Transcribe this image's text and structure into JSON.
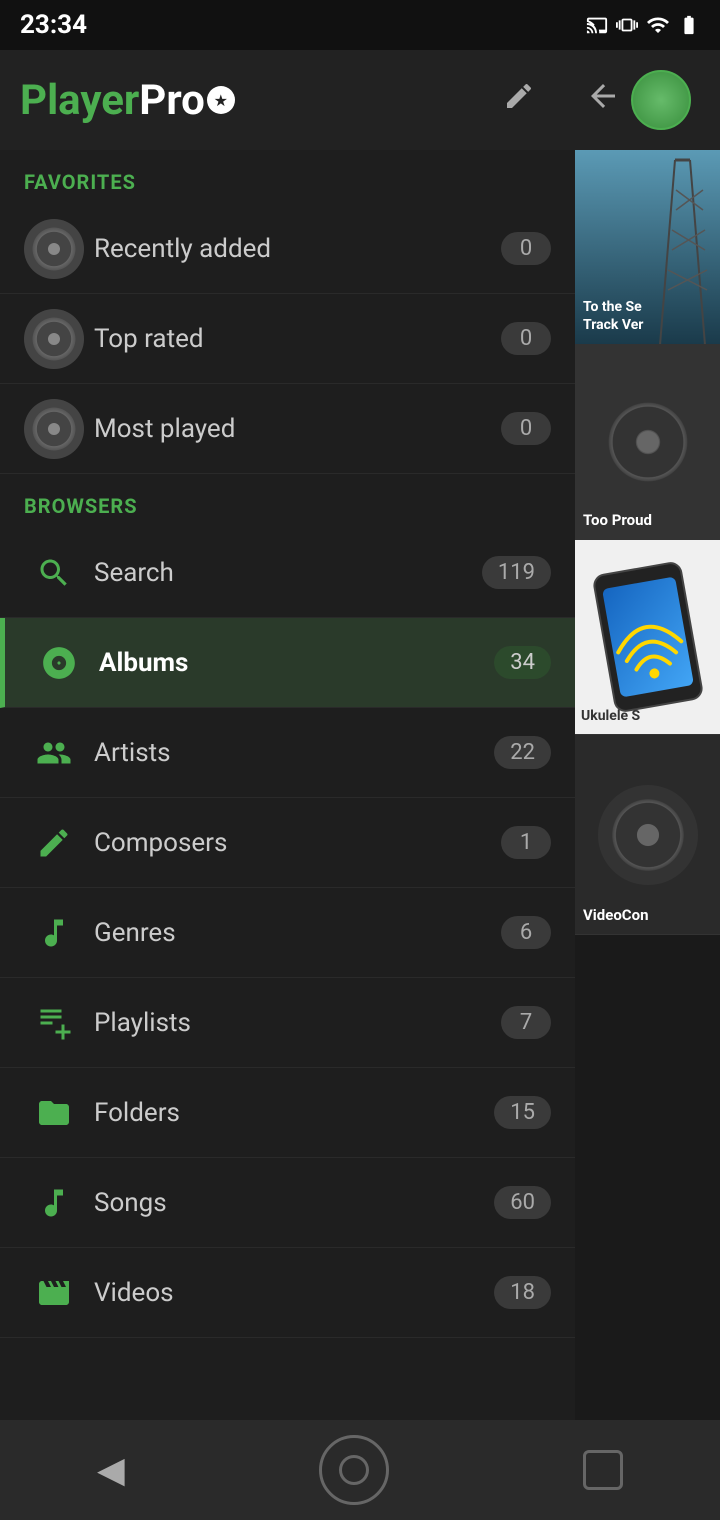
{
  "status": {
    "time": "23:34",
    "icons": [
      "cast",
      "vibrate",
      "wifi",
      "battery"
    ]
  },
  "header": {
    "logo_player": "Player",
    "logo_pro": "Pro",
    "edit_icon": "✏"
  },
  "right_panel": {
    "back_icon": "←",
    "card1": {
      "title": "To the Se",
      "subtitle": "Track Ver"
    },
    "card2": {
      "title": "Too Proud"
    },
    "card3": {
      "title": "Ukulele S"
    },
    "card4": {
      "title": "VideoCon"
    }
  },
  "drawer": {
    "favorites_label": "FAVORITES",
    "browsers_label": "BROWSERS",
    "items_favorites": [
      {
        "id": "recently-added",
        "label": "Recently added",
        "count": "0"
      },
      {
        "id": "top-rated",
        "label": "Top rated",
        "count": "0"
      },
      {
        "id": "most-played",
        "label": "Most played",
        "count": "0"
      }
    ],
    "items_browsers": [
      {
        "id": "search",
        "label": "Search",
        "count": "119",
        "active": false
      },
      {
        "id": "albums",
        "label": "Albums",
        "count": "34",
        "active": true
      },
      {
        "id": "artists",
        "label": "Artists",
        "count": "22",
        "active": false
      },
      {
        "id": "composers",
        "label": "Composers",
        "count": "1",
        "active": false
      },
      {
        "id": "genres",
        "label": "Genres",
        "count": "6",
        "active": false
      },
      {
        "id": "playlists",
        "label": "Playlists",
        "count": "7",
        "active": false
      },
      {
        "id": "folders",
        "label": "Folders",
        "count": "15",
        "active": false
      },
      {
        "id": "songs",
        "label": "Songs",
        "count": "60",
        "active": false
      },
      {
        "id": "videos",
        "label": "Videos",
        "count": "18",
        "active": false
      }
    ]
  },
  "bottom_nav": {
    "back_icon": "◀",
    "home_label": "home",
    "square_label": "recent"
  }
}
